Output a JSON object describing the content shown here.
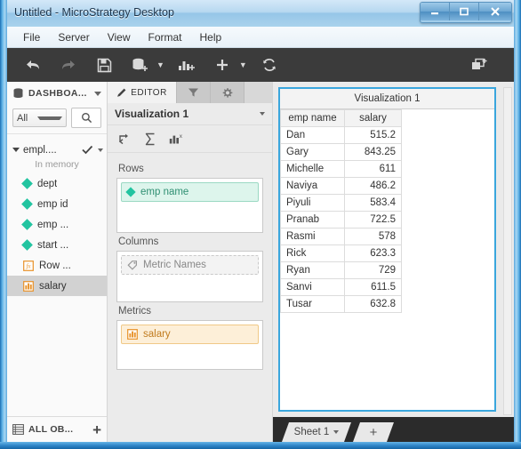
{
  "window": {
    "title": "Untitled - MicroStrategy Desktop",
    "minimize_label": "Minimize",
    "maximize_label": "Maximize",
    "close_label": "Close"
  },
  "menu": {
    "items": [
      {
        "label": "File"
      },
      {
        "label": "Server"
      },
      {
        "label": "View"
      },
      {
        "label": "Format"
      },
      {
        "label": "Help"
      }
    ]
  },
  "toolbar": {
    "items": [
      {
        "name": "undo-icon",
        "label": "Undo"
      },
      {
        "name": "redo-icon",
        "label": "Redo"
      },
      {
        "name": "save-icon",
        "label": "Save"
      },
      {
        "name": "add-data-icon",
        "label": "Add Data"
      },
      {
        "name": "add-visualization-icon",
        "label": "Add Visualization"
      },
      {
        "name": "add-icon",
        "label": "Add"
      },
      {
        "name": "refresh-icon",
        "label": "Refresh"
      },
      {
        "name": "add-panel-icon",
        "label": "Add Panel"
      }
    ]
  },
  "dataset_panel": {
    "header_label": "DASHBOA...",
    "filter_value": "All",
    "search_placeholder": "Search",
    "dataset": {
      "name": "empl....",
      "status": "In memory"
    },
    "objects": [
      {
        "label": "dept",
        "type": "attribute"
      },
      {
        "label": "emp id",
        "type": "attribute"
      },
      {
        "label": "emp ...",
        "type": "attribute"
      },
      {
        "label": "start ...",
        "type": "attribute"
      },
      {
        "label": "Row ...",
        "type": "derived"
      },
      {
        "label": "salary",
        "type": "metric",
        "selected": true
      }
    ],
    "footer_label": "ALL OB...",
    "footer_add_label": "+"
  },
  "editor_panel": {
    "tabs": [
      {
        "label": "EDITOR",
        "icon": "pencil-icon",
        "active": true
      },
      {
        "label": "",
        "icon": "filter-icon",
        "active": false
      },
      {
        "label": "",
        "icon": "gear-icon",
        "active": false
      }
    ],
    "visualization_name": "Visualization 1",
    "tool_icons": [
      {
        "name": "swap-rows-columns-icon",
        "glyph": "↱"
      },
      {
        "name": "totals-icon",
        "glyph": "Σ"
      },
      {
        "name": "visualization-type-icon",
        "glyph": "chart"
      }
    ],
    "shelves": [
      {
        "label": "Rows",
        "items": [
          {
            "label": "emp name",
            "type": "attribute"
          }
        ]
      },
      {
        "label": "Columns",
        "items": [
          {
            "label": "Metric Names",
            "type": "placeholder"
          }
        ]
      },
      {
        "label": "Metrics",
        "items": [
          {
            "label": "salary",
            "type": "metric"
          }
        ]
      }
    ]
  },
  "visualization": {
    "title": "Visualization 1",
    "columns": [
      "emp name",
      "salary"
    ],
    "rows": [
      {
        "emp_name": "Dan",
        "salary": "515.2"
      },
      {
        "emp_name": "Gary",
        "salary": "843.25"
      },
      {
        "emp_name": "Michelle",
        "salary": "611"
      },
      {
        "emp_name": "Naviya",
        "salary": "486.2"
      },
      {
        "emp_name": "Piyuli",
        "salary": "583.4"
      },
      {
        "emp_name": "Pranab",
        "salary": "722.5"
      },
      {
        "emp_name": "Rasmi",
        "salary": "578"
      },
      {
        "emp_name": "Rick",
        "salary": "623.3"
      },
      {
        "emp_name": "Ryan",
        "salary": "729"
      },
      {
        "emp_name": "Sanvi",
        "salary": "611.5"
      },
      {
        "emp_name": "Tusar",
        "salary": "632.8"
      }
    ]
  },
  "sheet_bar": {
    "sheet_label": "Sheet 1",
    "add_sheet_label": "+"
  },
  "colors": {
    "attribute": "#22c4a0",
    "metric": "#e8922a",
    "selection": "#3aa6dd",
    "toolbar_bg": "#3b3b3b"
  }
}
